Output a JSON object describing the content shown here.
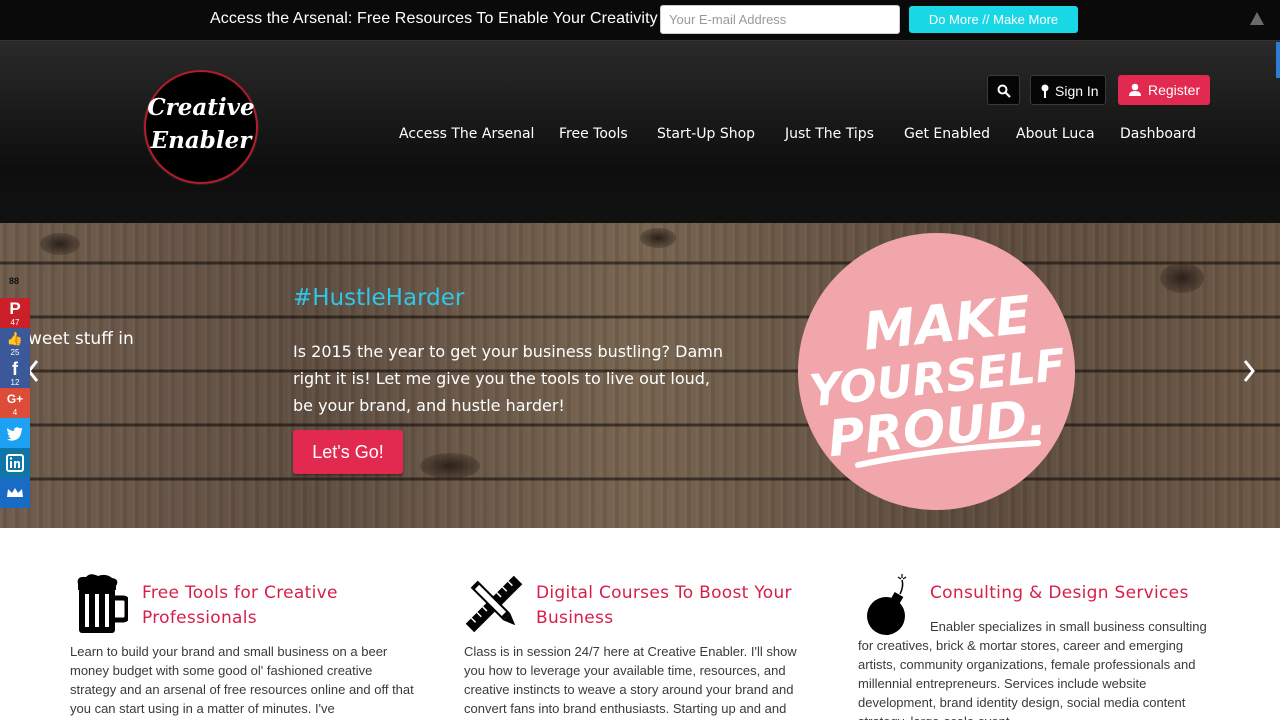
{
  "optin": {
    "headline": "Access the Arsenal: Free Resources To Enable Your Creativity",
    "email_placeholder": "Your E-mail Address",
    "submit_label": "Do More // Make More"
  },
  "header": {
    "logo_line1": "Creative",
    "logo_line2": "Enabler",
    "sign_in_label": "Sign In",
    "register_label": "Register",
    "nav": [
      "Access The Arsenal",
      "Free Tools",
      "Start-Up Shop",
      "Just The Tips",
      "Get Enabled",
      "About Luca",
      "Dashboard"
    ]
  },
  "hero": {
    "prev_slide_text": "weet stuff in",
    "hashtag": "#HustleHarder",
    "body": "Is 2015 the year to get your business bustling?  Damn right it is!  Let me give you the tools to live out loud, be your brand, and hustle harder!",
    "cta_label": "Let's Go!",
    "badge_line1": "MAKE",
    "badge_line2": "YOURSELF",
    "badge_line3": "PROUD."
  },
  "share": {
    "total": "88",
    "buttons": [
      {
        "network": "pinterest",
        "glyph": "P",
        "count": "47",
        "color": "#cb2027"
      },
      {
        "network": "like",
        "glyph": "👍",
        "count": "25",
        "color": "#3b5998"
      },
      {
        "network": "facebook",
        "glyph": "f",
        "count": "12",
        "color": "#3b5998"
      },
      {
        "network": "google-plus",
        "glyph": "G+",
        "count": "4",
        "color": "#dd4b39"
      },
      {
        "network": "twitter",
        "glyph": "🐦",
        "count": "",
        "color": "#1da1f2"
      },
      {
        "network": "linkedin",
        "glyph": "in",
        "count": "",
        "color": "#0e76a8"
      },
      {
        "network": "crown",
        "glyph": "♛",
        "count": "",
        "color": "#1a6bc4"
      }
    ]
  },
  "features": [
    {
      "title": "Free Tools for Creative Professionals",
      "body": "Learn to build your brand and small business on a beer money budget with some good ol' fashioned creative strategy and an arsenal of free resources online and off that you can start using in a matter of minutes.  I've"
    },
    {
      "title": "Digital Courses To Boost Your Business",
      "body": "Class is in session 24/7 here at Creative Enabler.  I'll show you how to leverage your available time, resources, and creative instincts to weave a story around your brand and convert fans into brand enthusiasts.  Starting up and and"
    },
    {
      "title": "Consulting & Design Services",
      "body": "Enabler specializes in small business consulting for creatives, brick & mortar stores, career and emerging artists, community organizations, female professionals and millennial entrepreneurs.  Services include website development, brand identity design, social media content strategy, large-scale event"
    }
  ],
  "colors": {
    "accent_red": "#e2294f",
    "accent_cyan": "#1ad7e6",
    "feature_title": "#d71e4a"
  }
}
